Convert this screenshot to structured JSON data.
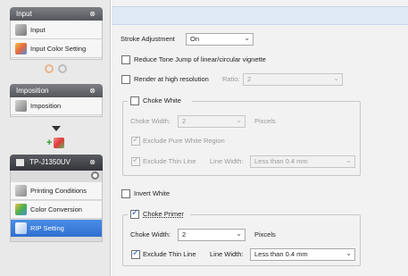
{
  "sidebar": {
    "input_panel": {
      "title": "Input",
      "collapse_glyph": "⊗",
      "items": [
        {
          "label": "Input",
          "icon": "input-icon"
        },
        {
          "label": "Input Color Setting",
          "icon": "color-setting-icon"
        }
      ]
    },
    "imposition_panel": {
      "title": "Imposition",
      "collapse_glyph": "⊗",
      "items": [
        {
          "label": "Imposition",
          "icon": "imposition-icon"
        }
      ]
    },
    "add_glyph": "+",
    "printer_panel": {
      "title": "TP-J1350UV",
      "collapse_glyph": "⊗",
      "items": [
        {
          "label": "Printing Conditions",
          "icon": "printing-conditions-icon"
        },
        {
          "label": "Color Conversion",
          "icon": "color-conversion-icon"
        },
        {
          "label": "RIP Setting",
          "icon": "rip-setting-icon",
          "selected": true
        }
      ]
    }
  },
  "main": {
    "stroke_adjustment": {
      "label": "Stroke Adjustment",
      "value": "On"
    },
    "reduce_tone_jump": {
      "label": "Reduce Tone Jump of linear/circular vignette",
      "checked": false
    },
    "render_high_res": {
      "label": "Render at high resolution",
      "ratio_label": "Ratio:",
      "ratio_value": "2",
      "checked": false
    },
    "choke_white": {
      "label": "Choke White",
      "checked": false,
      "width_label": "Choke Width:",
      "width_value": "2",
      "width_unit": "Pixcels",
      "exclude_pure_white_label": "Exclude Pure White Region",
      "exclude_thin_line_label": "Exclude Thin Line",
      "line_width_label": "Line Width:",
      "line_width_value": "Less than 0.4 mm"
    },
    "invert_white": {
      "label": "Invert White",
      "checked": false
    },
    "choke_primer": {
      "label": "Choke Primer",
      "checked": true,
      "width_label": "Choke Width:",
      "width_value": "2",
      "width_unit": "Pixcels",
      "exclude_thin_line_label": "Exclude Thin Line",
      "exclude_thin_line_checked": true,
      "line_width_label": "Line Width:",
      "line_width_value": "Less than 0.4 mm"
    }
  },
  "colors": {
    "selected_item": "#2f6fd0",
    "header_dark": "#54565b",
    "topbar": "#dfe9f5",
    "checkmark": "#2c64c8"
  }
}
